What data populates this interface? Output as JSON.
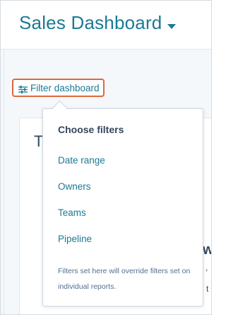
{
  "header": {
    "title": "Sales Dashboard"
  },
  "toolbar": {
    "filter_label": "Filter dashboard"
  },
  "card": {
    "title_fragment": "T",
    "fragment_w": "w",
    "fragment_a": ",",
    "fragment_b": "t"
  },
  "popover": {
    "title": "Choose filters",
    "options": [
      "Date range",
      "Owners",
      "Teams",
      "Pipeline"
    ],
    "note": "Filters set here will override filters set on individual reports."
  },
  "colors": {
    "accent": "#1b7a95",
    "highlight_border": "#d9693f",
    "text_dark": "#33475b",
    "text_muted": "#516f90"
  }
}
